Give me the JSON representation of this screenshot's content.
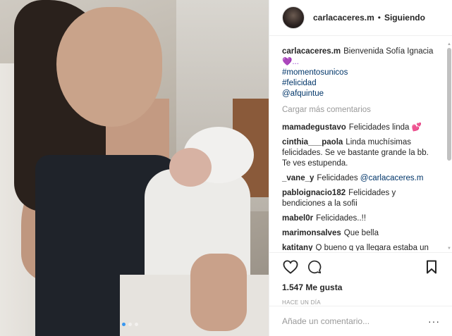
{
  "post": {
    "dots": 3
  },
  "header": {
    "username": "carlacaceres.m",
    "separator": "•",
    "follow_status": "Siguiendo"
  },
  "caption": {
    "username": "carlacaceres.m",
    "text": "Bienvenida Sofía Ignacia",
    "emoji_line": "💜...",
    "tags": [
      "#momentosunicos",
      "#felicidad",
      "@afquintue"
    ]
  },
  "load_more": "Cargar más comentarios",
  "comments": [
    {
      "user": "mamadegustavo",
      "text": "Felicidades linda",
      "emoji": "💕"
    },
    {
      "user": "cinthia___paola",
      "text": "Linda muchísimas felicidades. Se ve bastante grande la bb. Te ves estupenda."
    },
    {
      "user": "_vane_y",
      "text": "Felicidades",
      "mention": "@carlacaceres.m"
    },
    {
      "user": "pabloignacio182",
      "text": "Felicidades y bendiciones a la sofii"
    },
    {
      "user": "mabel0r",
      "text": "Felicidades..!!"
    },
    {
      "user": "marimonsalves",
      "text": "Que bella"
    },
    {
      "user": "katitany",
      "text": "Q bueno q ya llegara estaba un poco preocupada ya le escribía a Rafa."
    }
  ],
  "actions": {
    "like_icon": "heart-icon",
    "comment_icon": "comment-icon",
    "save_icon": "bookmark-icon"
  },
  "likes": "1.547 Me gusta",
  "timestamp": "HACE UN DÍA",
  "add_comment": {
    "placeholder": "Añade un comentario...",
    "more_label": "···"
  },
  "colors": {
    "link": "#003569",
    "muted": "#999999",
    "active_dot": "#3897f0"
  }
}
